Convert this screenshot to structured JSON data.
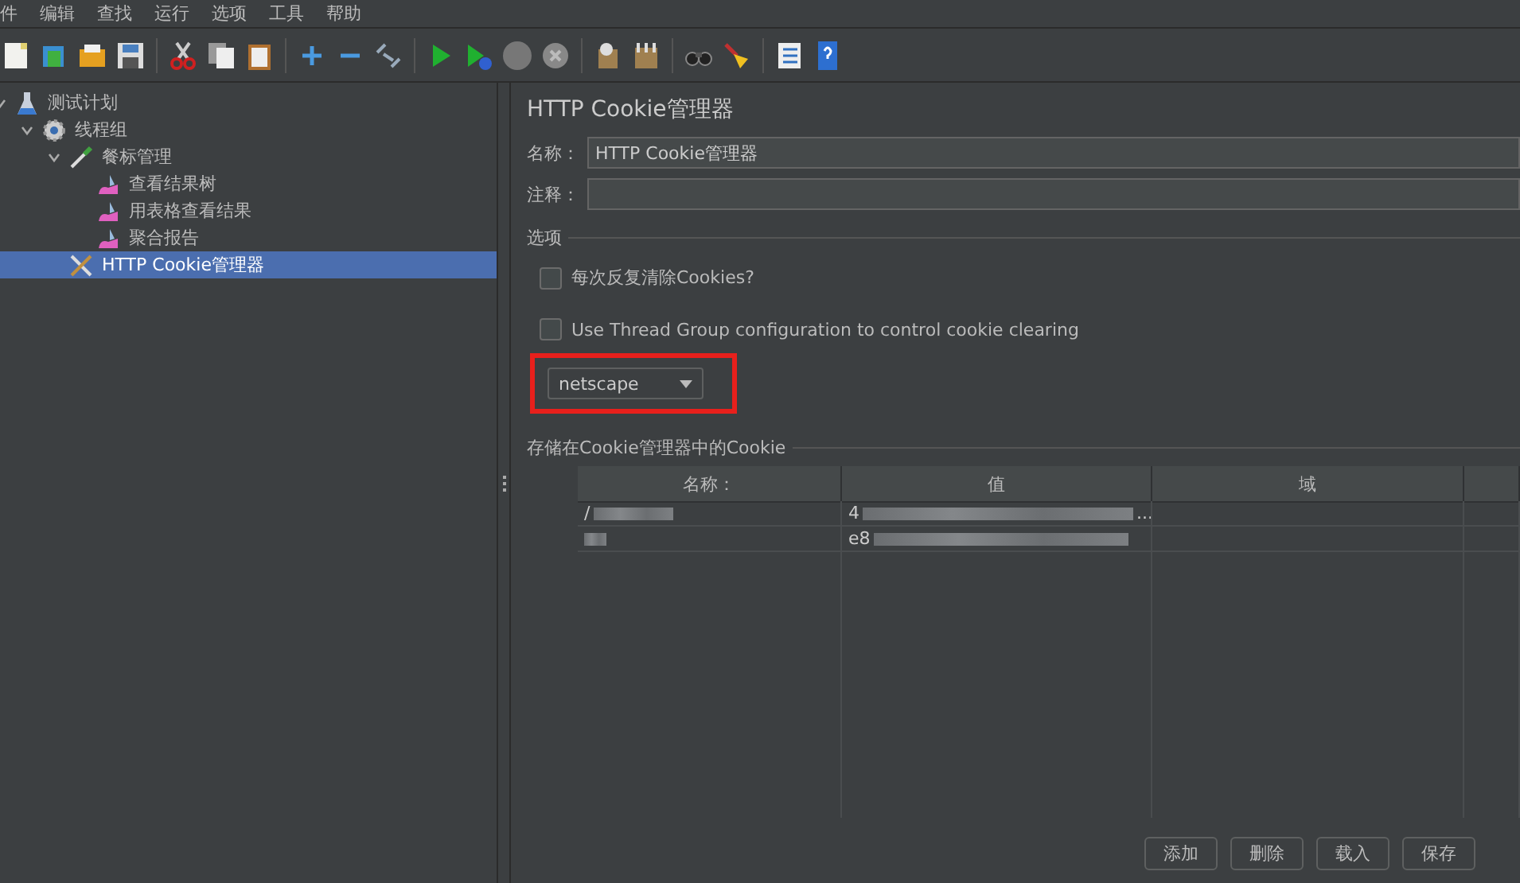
{
  "menu": [
    "件",
    "编辑",
    "查找",
    "运行",
    "选项",
    "工具",
    "帮助"
  ],
  "tree": [
    {
      "label": "测试计划",
      "kind": "plan",
      "expanded": true,
      "selected": false,
      "children": [
        {
          "label": "线程组",
          "kind": "thread-group",
          "expanded": true,
          "selected": false,
          "children": [
            {
              "label": "餐标管理",
              "kind": "sampler",
              "expanded": true,
              "selected": false,
              "children": [
                {
                  "label": "查看结果树",
                  "kind": "listener",
                  "selected": false
                },
                {
                  "label": "用表格查看结果",
                  "kind": "listener",
                  "selected": false
                },
                {
                  "label": "聚合报告",
                  "kind": "listener",
                  "selected": false
                }
              ]
            },
            {
              "label": "HTTP Cookie管理器",
              "kind": "config",
              "selected": true
            }
          ]
        }
      ]
    }
  ],
  "panel": {
    "title": "HTTP Cookie管理器",
    "name_label": "名称：",
    "name_value": "HTTP Cookie管理器",
    "comment_label": "注释：",
    "options_title": "选项",
    "checkboxes": [
      {
        "label": "每次反复清除Cookies?",
        "checked": false
      },
      {
        "label": "Use Thread Group configuration to control cookie clearing",
        "checked": false
      }
    ],
    "policy": {
      "value": "netscape"
    },
    "table_title": "存储在Cookie管理器中的Cookie",
    "columns": [
      "名称：",
      "值",
      "域"
    ],
    "rows": [
      {
        "name_shown": "/",
        "value_shown": "4",
        "value_end": "..."
      },
      {
        "value_shown": "e8"
      }
    ],
    "buttons": [
      "添加",
      "删除",
      "载入",
      "保存"
    ]
  }
}
